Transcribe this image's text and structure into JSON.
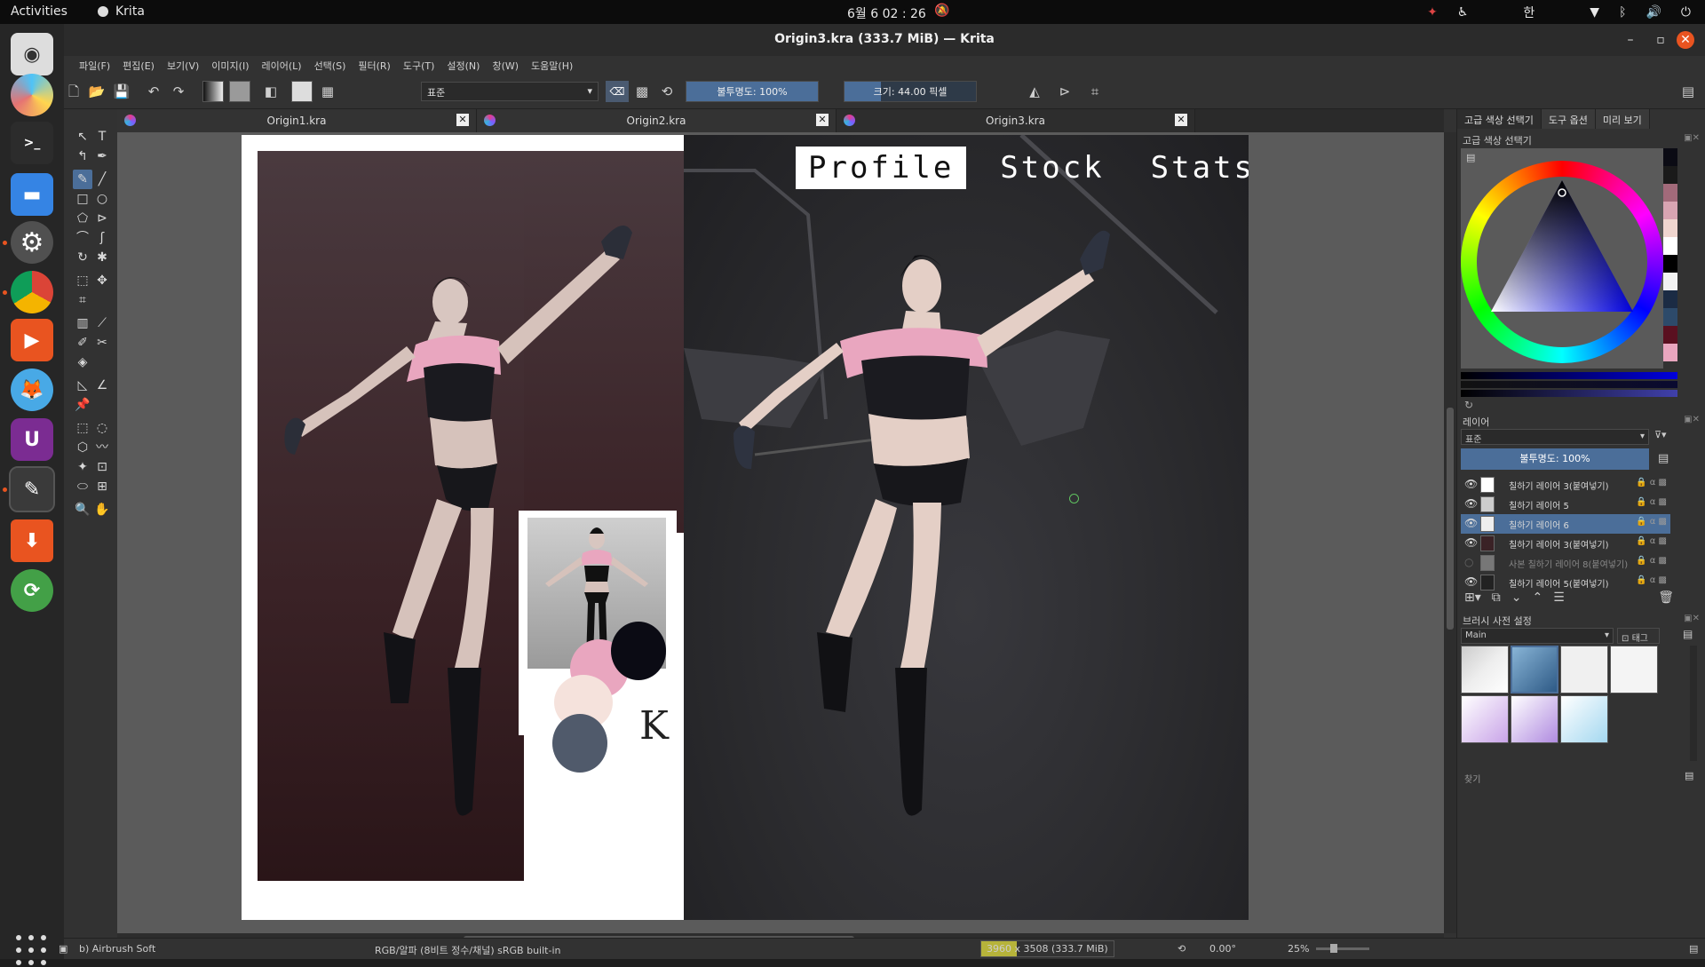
{
  "topbar": {
    "activities": "Activities",
    "app_name": "Krita",
    "clock": "6월 6 02 : 26",
    "input_method": "한"
  },
  "window": {
    "title": "Origin3.kra (333.7 MiB) — Krita"
  },
  "menu": [
    "파일(F)",
    "편집(E)",
    "보기(V)",
    "이미지(I)",
    "레이어(L)",
    "선택(S)",
    "필터(R)",
    "도구(T)",
    "설정(N)",
    "창(W)",
    "도움말(H)"
  ],
  "toolbar": {
    "blend_mode": "표준",
    "opacity_label": "불투명도: 100%",
    "size_label": "크기: 44.00 픽셀"
  },
  "tabs": [
    {
      "label": "Origin1.kra"
    },
    {
      "label": "Origin2.kra"
    },
    {
      "label": "Origin3.kra"
    }
  ],
  "canvas": {
    "menu_items": [
      "Profile",
      "Stock",
      "Stats"
    ],
    "signature": "K",
    "swatch_colors": [
      "#e9a6bf",
      "#0b0b14",
      "#f5e2dc",
      "#505a6b"
    ]
  },
  "right_panel": {
    "tabs": [
      "고급 색상 선택기",
      "도구 옵션",
      "미리 보기"
    ],
    "color_selector_title": "고급 색상 선택기",
    "layers_title": "레이어",
    "layer_blend_mode": "표준",
    "layer_opacity": "불투명도: 100%",
    "layers": [
      {
        "name": "칠하기 레이어 3(붙여넣기)",
        "visible": true,
        "selected": false
      },
      {
        "name": "칠하기 레이어 5",
        "visible": true,
        "selected": false
      },
      {
        "name": "칠하기 레이어 6",
        "visible": true,
        "selected": true
      },
      {
        "name": "칠하기 레이어 3(붙여넣기)",
        "visible": true,
        "selected": false
      },
      {
        "name": "사본 칠하기 레이어 8(붙여넣기)",
        "visible": false,
        "selected": false
      },
      {
        "name": "칠하기 레이어 5(붙여넣기)",
        "visible": true,
        "selected": false
      }
    ],
    "brush_title": "브러시 사전 설정",
    "brush_group": "Main",
    "brush_tag": "태그",
    "search_placeholder": "찾기"
  },
  "statusbar": {
    "brush_name": "b) Airbrush Soft",
    "color_space": "RGB/알파 (8비트 정수/채널)  sRGB built-in",
    "image_size": "3960 x 3508 (333.7 MiB)",
    "rotation": "0.00°",
    "zoom": "25%"
  },
  "colors": {
    "accent": "#4b6e99",
    "ubuntu_orange": "#e95420",
    "pink_top": "#e9a6bf"
  }
}
